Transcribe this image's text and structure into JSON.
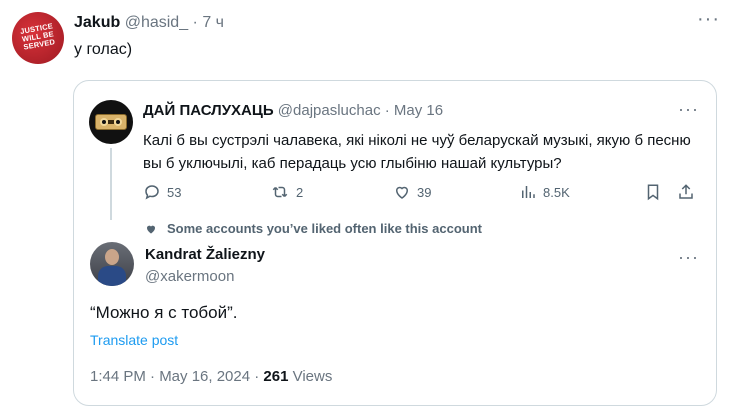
{
  "outer_post": {
    "avatar_text": "JUSTICE WILL BE SERVED",
    "name": "Jakub",
    "handle": "@hasid_",
    "separator": " · ",
    "time": "7 ч",
    "text": "у голас)",
    "more_label": "···"
  },
  "quoted_post": {
    "name": "ДАЙ ПАСЛУХАЦЬ",
    "handle": "@dajpasluchac",
    "separator": " · ",
    "date": "May 16",
    "more_label": "···",
    "text": "Калі б вы сустрэлі чалавека, які ніколі не чуў беларускай музыкі, якую б песню вы б уключылі, каб перадаць усю глыбіню нашай культуры?",
    "actions": {
      "replies": "53",
      "reposts": "2",
      "likes": "39",
      "views": "8.5K"
    }
  },
  "liked_note": "Some accounts you’ve liked often like this account",
  "reply_post": {
    "name": "Kandrat Žaliezny",
    "handle": "@xakermoon",
    "more_label": "···",
    "text": "“Можно я с тобой”.",
    "translate_label": "Translate post",
    "time": "1:44 PM · May 16, 2024 · ",
    "views_count": "261",
    "views_label": " Views"
  },
  "colors": {
    "muted_text": "#536471",
    "link": "#1d9bf0",
    "border": "#cfd9de",
    "avatar_red": "#d8323a"
  }
}
